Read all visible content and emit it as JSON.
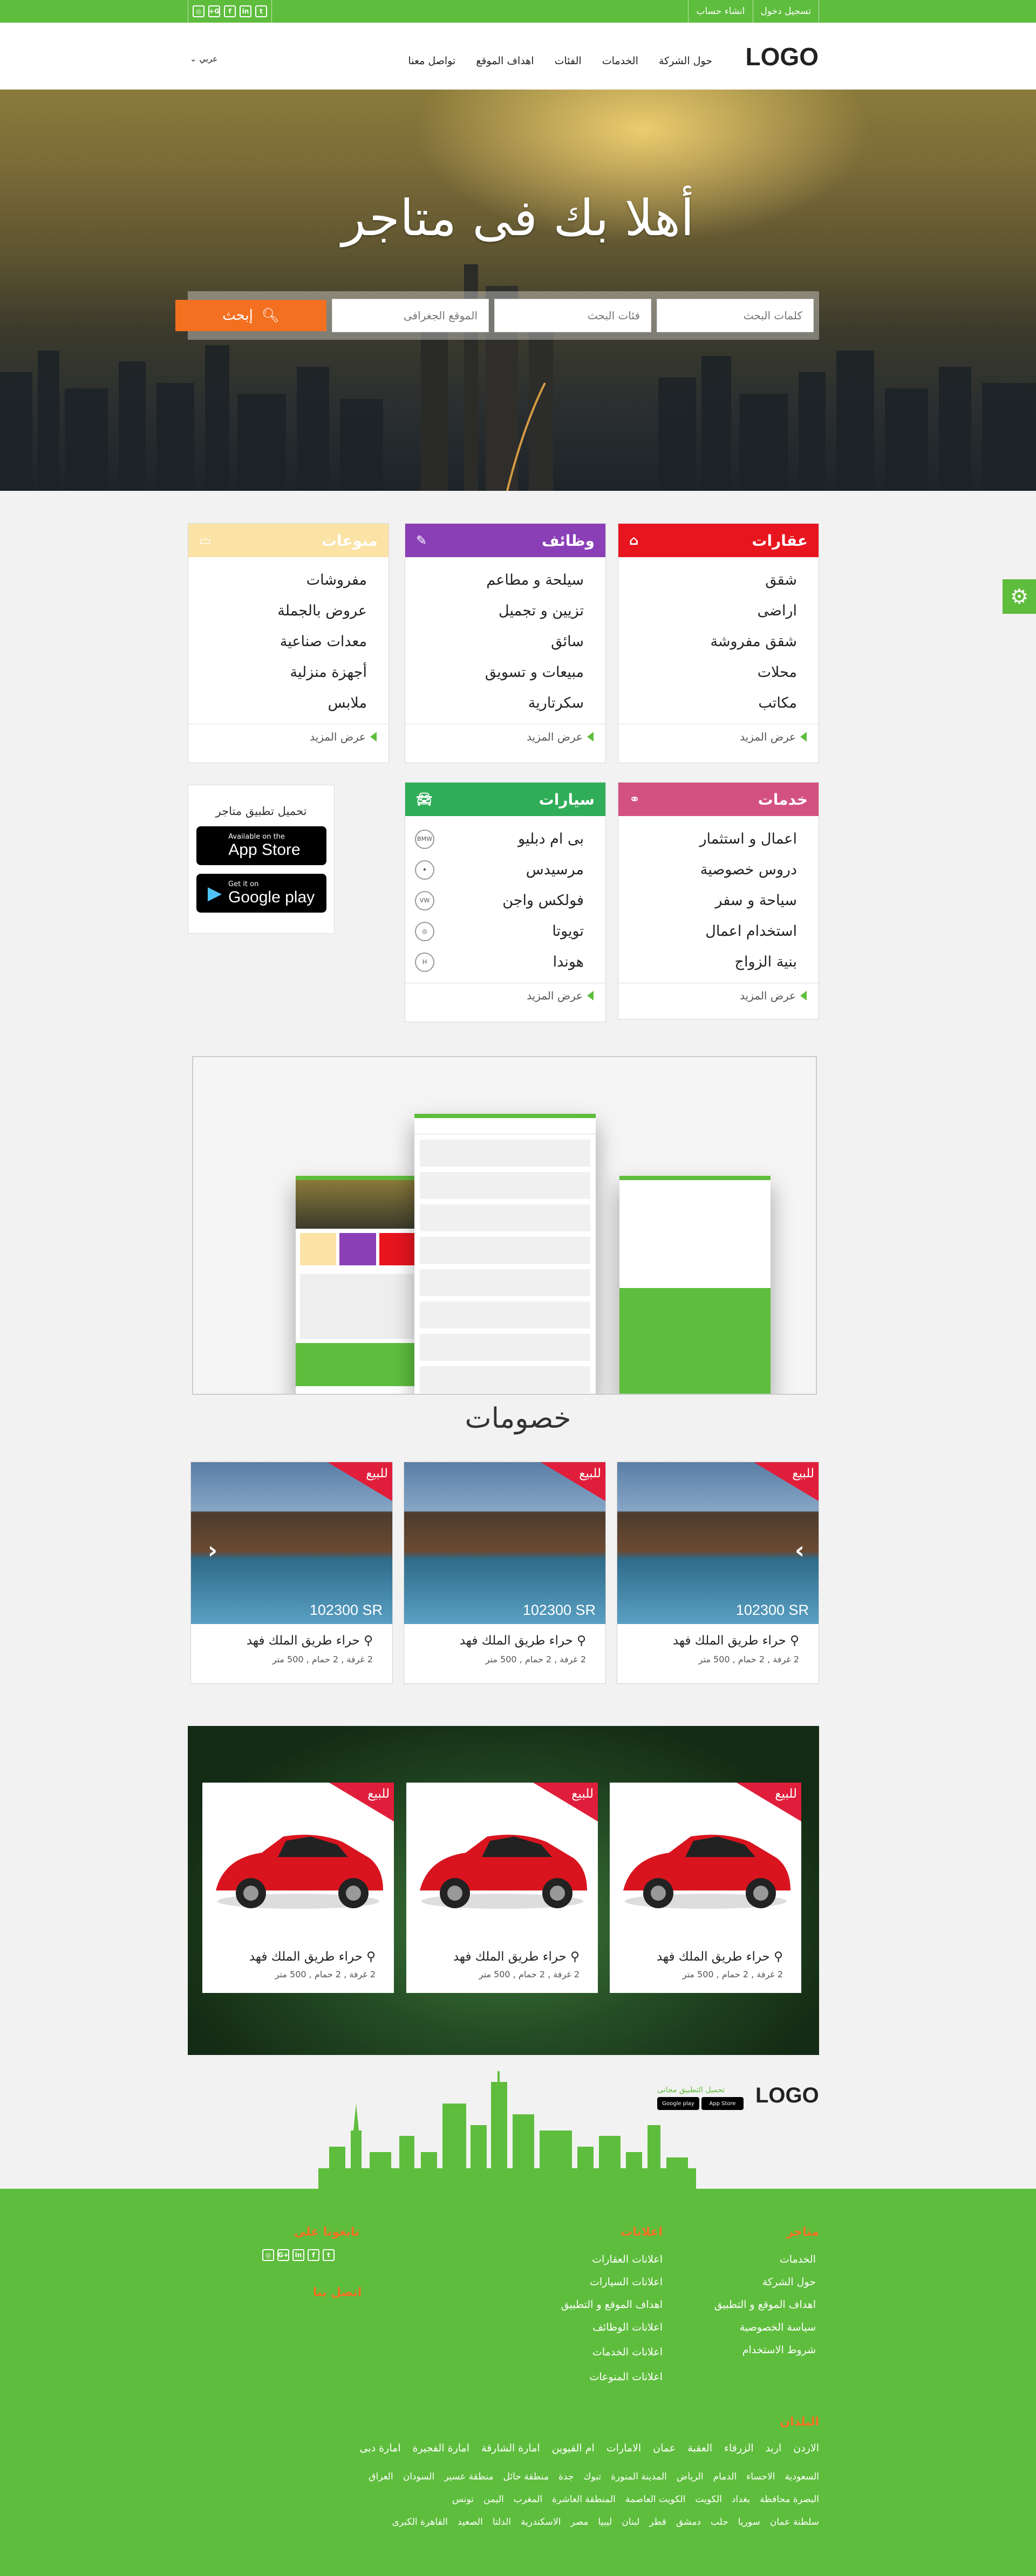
{
  "topbar": {
    "login": "تسجيل دخول",
    "register": "انشاء حساب",
    "social": [
      "twitter-icon",
      "linkedin-icon",
      "facebook-icon",
      "google-plus-icon",
      "instagram-icon"
    ]
  },
  "header": {
    "logo": "LOGO",
    "nav": [
      "حول الشركة",
      "الخدمات",
      "الفئات",
      "اهداف الموقع",
      "تواصل معنا"
    ],
    "language": "عربي"
  },
  "hero": {
    "title": "أهلا بك فى متاجر",
    "search": {
      "keywords_placeholder": "كلمات البحث",
      "category_placeholder": "فئات البحث",
      "location_placeholder": "الموقع الجغرافى",
      "button": "إبحث"
    }
  },
  "categories": {
    "realestate": {
      "title": "عقارات",
      "color": "#e8151f",
      "items": [
        "شقق",
        "اراضى",
        "شقق مفروشة",
        "محلات",
        "مكاتب"
      ],
      "more": "عرض المزيد"
    },
    "jobs": {
      "title": "وظائف",
      "color": "#8a3fb7",
      "items": [
        "سيلحة و مطاعم",
        "تزيين و تجميل",
        "سائق",
        "مبيعات و تسويق",
        "سكرتارية"
      ],
      "more": "عرض المزيد"
    },
    "misc": {
      "title": "منوعات",
      "color": "#fbe3a6",
      "items": [
        "مفروشات",
        "عروض بالجملة",
        "معدات صناعية",
        "أجهزة منزلية",
        "ملابس"
      ],
      "more": "عرض المزيد"
    },
    "services": {
      "title": "خدمات",
      "color": "#d35180",
      "items": [
        "اعمال و استثمار",
        "دروس خصوصية",
        "سياحة و سفر",
        "استخدام اعمال",
        "بنية الزواج"
      ],
      "more": "عرض المزيد"
    },
    "cars": {
      "title": "سيارات",
      "color": "#30ad58",
      "items": [
        "بى ام دبليو",
        "مرسيدس",
        "فولكس واجن",
        "تويوتا",
        "هوندا"
      ],
      "more": "عرض المزيد"
    }
  },
  "app": {
    "title": "تحميل تطبيق متاجر",
    "appstore_top": "Available on the",
    "appstore_name": "App Store",
    "google_top": "Get it on",
    "google_name": "Google play"
  },
  "discounts": {
    "title": "خصومات",
    "cards": [
      {
        "badge": "للبيع",
        "price": "102300 SR",
        "location": "حراء طريق الملك فهد",
        "details": "2 غرفة , 2 حمام , 500 متر"
      },
      {
        "badge": "للبيع",
        "price": "102300 SR",
        "location": "حراء طريق الملك فهد",
        "details": "2 غرفة , 2 حمام , 500 متر"
      },
      {
        "badge": "للبيع",
        "price": "102300 SR",
        "location": "حراء طريق الملك فهد",
        "details": "2 غرفة , 2 حمام , 500 متر"
      }
    ]
  },
  "cars_section": {
    "cards": [
      {
        "badge": "للبيع",
        "location": "حراء طريق الملك فهد",
        "details": "2 غرفة , 2 حمام , 500 متر"
      },
      {
        "badge": "للبيع",
        "location": "حراء طريق الملك فهد",
        "details": "2 غرفة , 2 حمام , 500 متر"
      },
      {
        "badge": "للبيع",
        "location": "حراء طريق الملك فهد",
        "details": "2 غرفة , 2 حمام , 500 متر"
      }
    ]
  },
  "footer": {
    "logo": "LOGO",
    "app_label": "تحميل التطبيق مجانى",
    "appstore": "App Store",
    "google": "Google play",
    "col_site": {
      "title": "متاجر",
      "links": [
        "الخدمات",
        "حول الشركة",
        "اهداف الموقع و التطبيق",
        "سياسة الخصوصية",
        "شروط الاستخدام"
      ]
    },
    "col_ads": {
      "title": "اعلانات",
      "links": [
        "اعلانات العقارات",
        "اعلانات السيارات",
        "اهداف الموقع و التطبيق",
        "اعلانات الوظائف",
        "اعلانات الخدمات",
        "اعلانات المنوعات"
      ]
    },
    "follow": "تابعونا على",
    "contact": "اتصل بنا",
    "countries_title": "البلدان",
    "cities_row1": [
      "الاردن",
      "اربد",
      "الزرقاء",
      "العقبة",
      "عمان",
      "الامارات",
      "ام القيوين",
      "امارة الشارقة",
      "امارة الفجيرة",
      "امارة دبى"
    ],
    "cities_row2": [
      "السعودية",
      "الاحساء",
      "الدمام",
      "الرياض",
      "المدينة المنورة",
      "تبوك",
      "جدة",
      "منطقة حائل",
      "منطقة عسير",
      "السودان",
      "العراق"
    ],
    "cities_row3": [
      "البصرة محافظة",
      "بغداد",
      "الكويت",
      "الكويت العاصمة",
      "المنطقة العاشرة",
      "المغرب",
      "اليمن",
      "تونس"
    ],
    "cities_row4": [
      "سلطنة عمان",
      "سوريا",
      "حلب",
      "دمشق",
      "قطر",
      "لبنان",
      "ليبيا",
      "مصر",
      "الاسكندرية",
      "الدلتا",
      "الصعيد",
      "القاهرة الكبرى"
    ]
  },
  "colors": {
    "green": "#5fbd3e",
    "orange": "#f37021",
    "sale_red": "#e01e3b"
  }
}
